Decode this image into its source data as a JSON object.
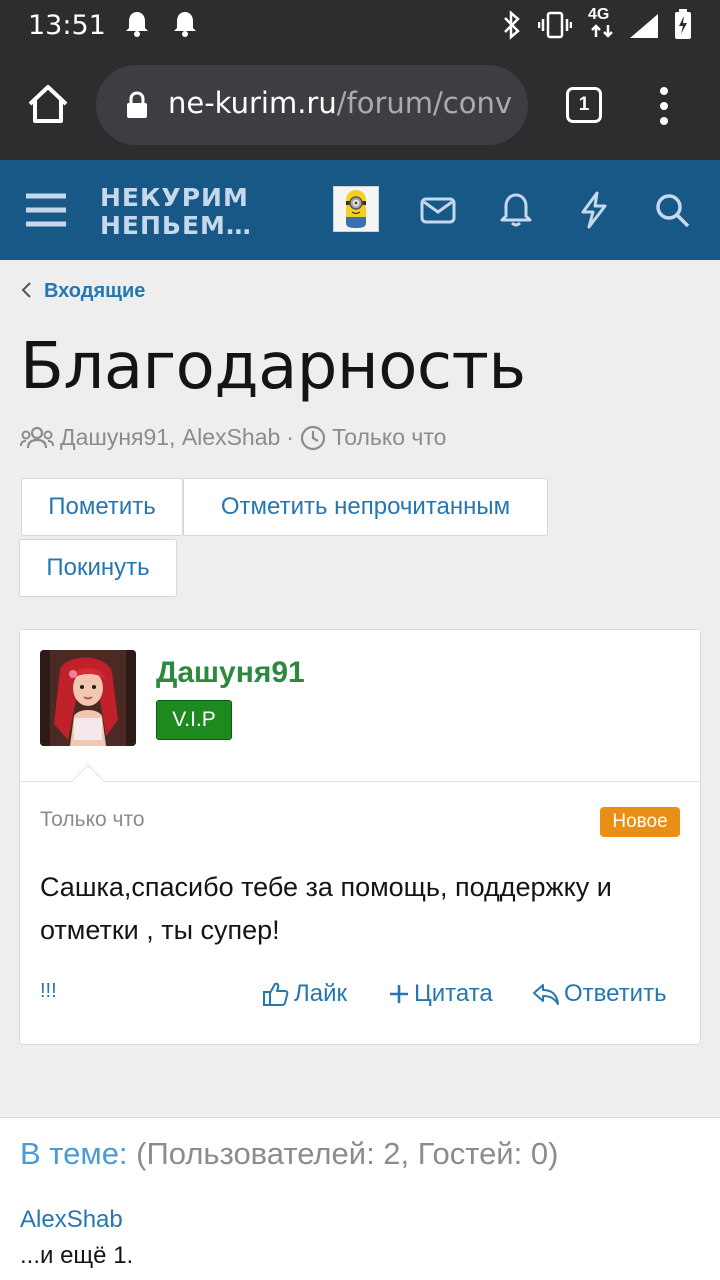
{
  "status_bar": {
    "time": "13:51",
    "network": "4G",
    "icons": [
      "bell-icon",
      "bell-icon",
      "bluetooth-icon",
      "vibrate-icon",
      "signal-icon",
      "battery-icon"
    ]
  },
  "browser": {
    "url_host": "ne-kurim.ru",
    "url_path": "/forum/conv",
    "tab_count": "1"
  },
  "site_header": {
    "logo_line1": "НЕКУРИМ",
    "logo_line2": "НЕПЬЕМ…",
    "icons": [
      "menu-icon",
      "mail-icon",
      "bell-icon",
      "lightning-icon",
      "search-icon"
    ]
  },
  "breadcrumb": {
    "label": "Входящие"
  },
  "page": {
    "title": "Благодарность",
    "participants": "Дашуня91, AlexShab",
    "separator": "·",
    "time": "Только что"
  },
  "buttons": {
    "mark": "Пометить",
    "mark_unread": "Отметить непрочитанным",
    "leave": "Покинуть"
  },
  "message": {
    "username": "Дашуня91",
    "badge": "V.I.P",
    "time": "Только что",
    "new_label": "Новое",
    "text": "Сашка,спасибо тебе за помощь, поддержку и отметки , ты супер!",
    "report": "!!!",
    "like": "Лайк",
    "quote": "Цитата",
    "reply": "Ответить"
  },
  "in_thread": {
    "label": "В теме:",
    "counts": "(Пользователей: 2, Гостей: 0)",
    "user": "AlexShab",
    "more": "...и ещё 1."
  },
  "colors": {
    "header_bg": "#185886",
    "link": "#2577b1",
    "username": "#2c8a3f",
    "vip_badge": "#1c8a1e",
    "new_badge": "#ea8f16"
  }
}
